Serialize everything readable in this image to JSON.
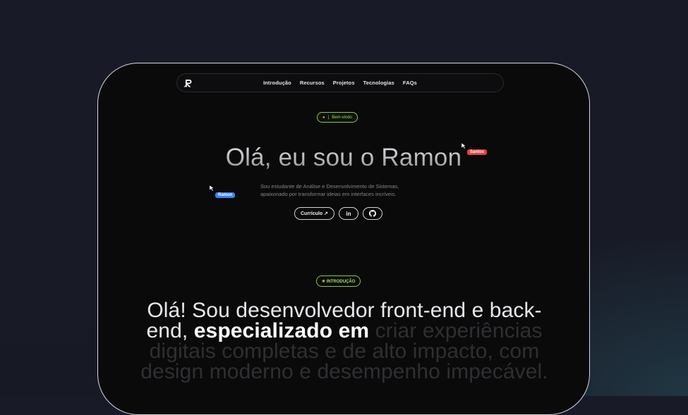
{
  "nav": {
    "logo": "R",
    "links": [
      "Introdução",
      "Recursos",
      "Projetos",
      "Tecnologias",
      "FAQs"
    ]
  },
  "hero": {
    "badge": {
      "icon": "rocket-icon",
      "separator": "|",
      "label": "Bem-vindo"
    },
    "title": "Olá, eu sou o Ramon",
    "subtitle_line1": "Sou estudante de Análise e Desenvolvimento de Sistemas,",
    "subtitle_line2": "apaixonado por transformar ideias em interfaces incríveis.",
    "cursor_santos": "Santos",
    "cursor_ramon": "Ramon",
    "cv_button": "Currículo ↗",
    "linkedin_label": "in",
    "github_icon": "github-icon"
  },
  "intro": {
    "badge": "✳ INTRODUÇÃO",
    "text_bright": "Olá! Sou desenvolvedor front-end e back-end,",
    "text_white": "especializado em",
    "text_dim": "criar experiências digitais completas e de alto impacto, com design moderno e desempenho impecável."
  },
  "colors": {
    "accent_green": "#8fc93a",
    "tag_santos": "#e04343",
    "tag_ramon": "#3b82f6"
  }
}
